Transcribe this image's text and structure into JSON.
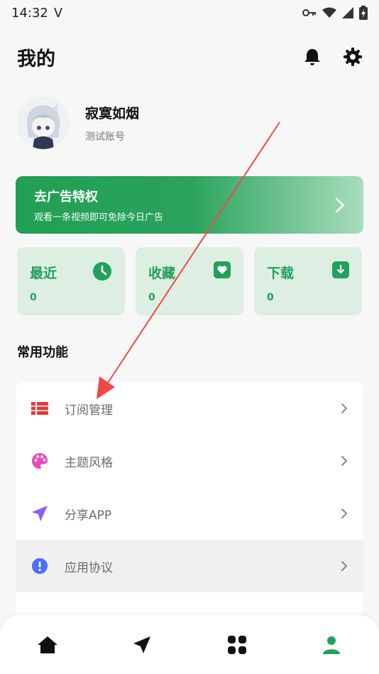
{
  "status_bar": {
    "time": "14:32",
    "carrier_icon": "V"
  },
  "header": {
    "title": "我的",
    "icons": [
      "bell-icon",
      "gear-icon"
    ]
  },
  "profile": {
    "username": "寂寞如烟",
    "account_tag": "测试账号"
  },
  "promo": {
    "title": "去广告特权",
    "subtitle": "观看一条视频即可免除今日广告"
  },
  "stats": [
    {
      "label": "最近",
      "count": "0",
      "icon": "clock-icon"
    },
    {
      "label": "收藏",
      "count": "0",
      "icon": "heart-icon"
    },
    {
      "label": "下载",
      "count": "0",
      "icon": "download-icon"
    }
  ],
  "section": {
    "title": "常用功能"
  },
  "menu": [
    {
      "label": "订阅管理",
      "icon": "list-icon",
      "color": "#e53935"
    },
    {
      "label": "主题风格",
      "icon": "palette-icon",
      "color": "#e84dbb"
    },
    {
      "label": "分享APP",
      "icon": "send-icon",
      "color": "#8b5cf6"
    },
    {
      "label": "应用协议",
      "icon": "info-icon",
      "color": "#4f6ef7"
    }
  ],
  "bottom_nav": [
    "home-icon",
    "discover-icon",
    "apps-icon",
    "profile-icon"
  ],
  "colors": {
    "accent": "#23a05a",
    "annotation_arrow": "#f04848"
  }
}
